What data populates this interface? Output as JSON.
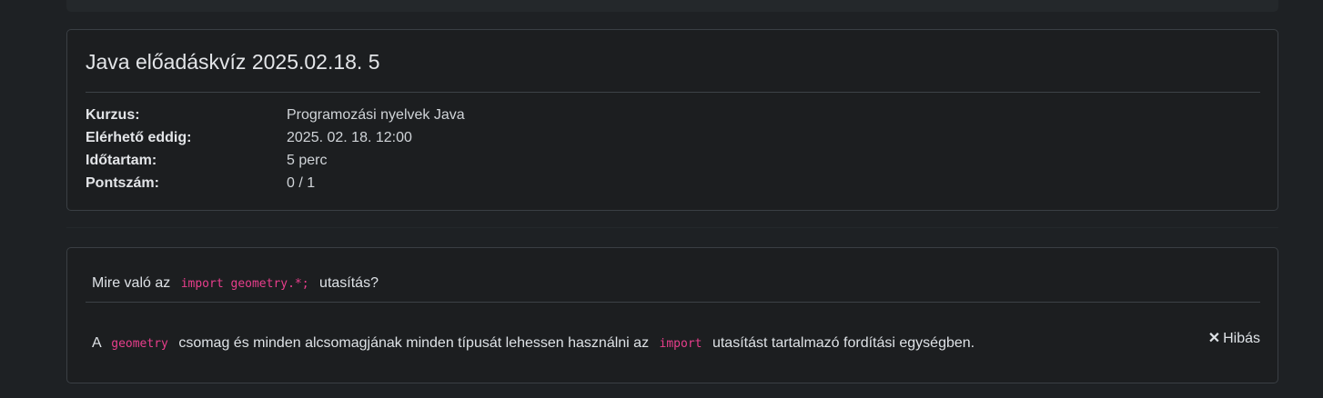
{
  "quiz": {
    "title": "Java előadáskvíz 2025.02.18. 5",
    "info": [
      {
        "label": "Kurzus:",
        "value": "Programozási nyelvek Java"
      },
      {
        "label": "Elérhető eddig:",
        "value": "2025. 02. 18. 12:00"
      },
      {
        "label": "Időtartam:",
        "value": "5 perc"
      },
      {
        "label": "Pontszám:",
        "value": "0 / 1"
      }
    ]
  },
  "question": {
    "prefix": "Mire való az",
    "code": "import geometry.*;",
    "suffix": "utasítás?"
  },
  "answer": {
    "part1": "A",
    "code1": "geometry",
    "part2": "csomag és minden alcsomagjának minden típusát lehessen használni az",
    "code2": "import",
    "part3": "utasítást tartalmazó fordítási egységben.",
    "status_icon": "✕",
    "status_label": "Hibás",
    "status_icon_name": "close-icon"
  },
  "colors": {
    "background": "#1e2124",
    "card": "#1c1e20",
    "code": "#e83e8c"
  }
}
